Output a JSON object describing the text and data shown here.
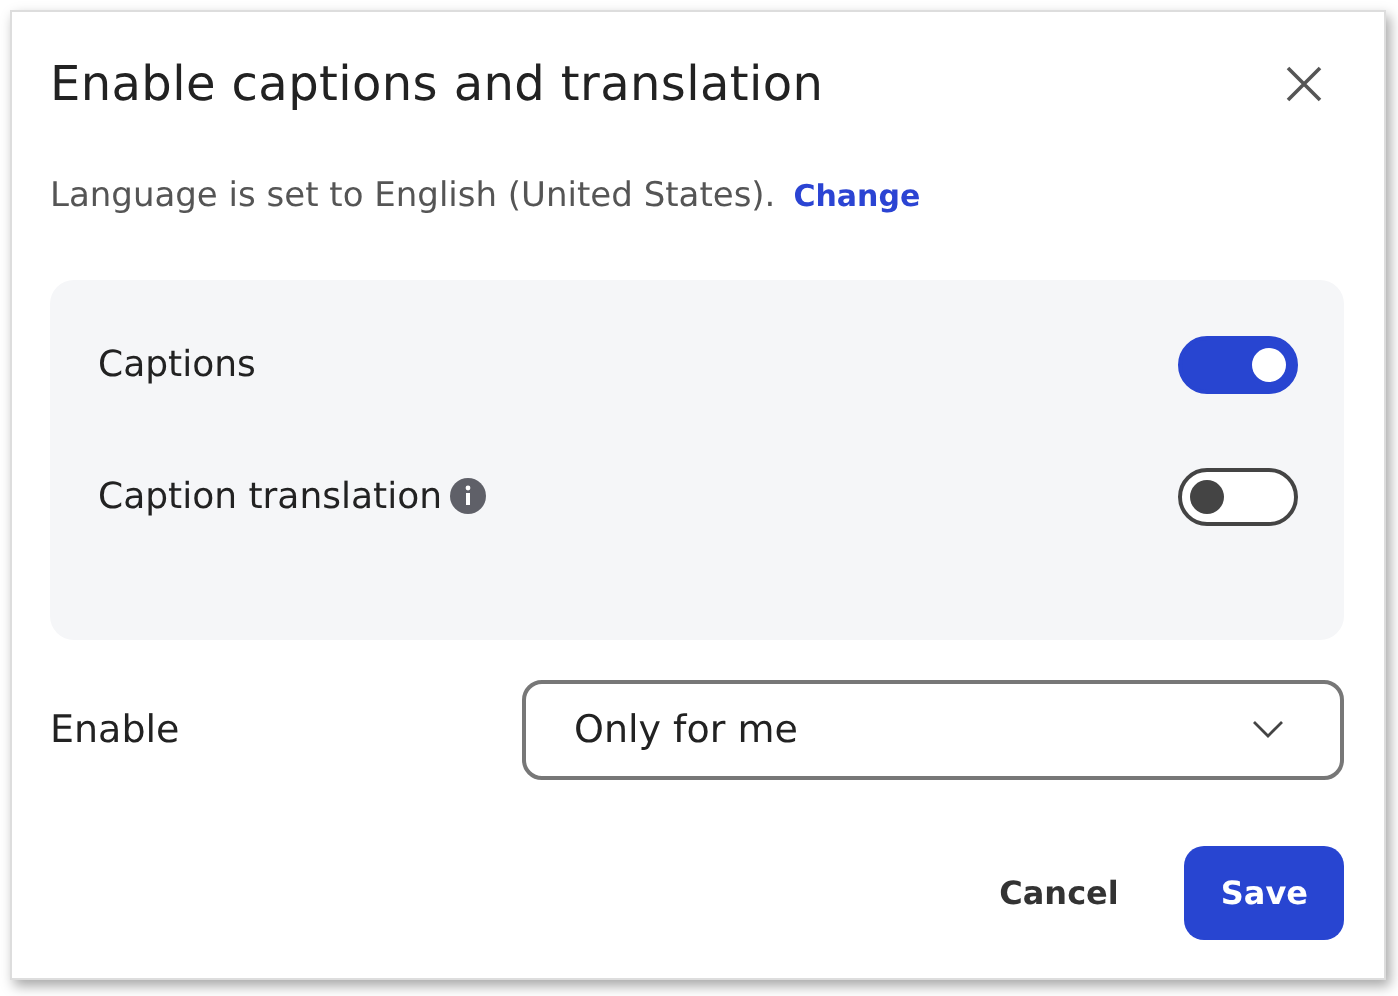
{
  "dialog": {
    "title": "Enable captions and translation",
    "language_text": "Language is set to English (United States).",
    "change_link": "Change"
  },
  "settings": [
    {
      "label": "Captions",
      "info": false,
      "on": true
    },
    {
      "label": "Caption translation",
      "info": true,
      "on": false
    }
  ],
  "enable": {
    "label": "Enable",
    "value": "Only for me"
  },
  "buttons": [
    {
      "label": "Cancel",
      "kind": "secondary"
    },
    {
      "label": "Save",
      "kind": "primary"
    }
  ]
}
